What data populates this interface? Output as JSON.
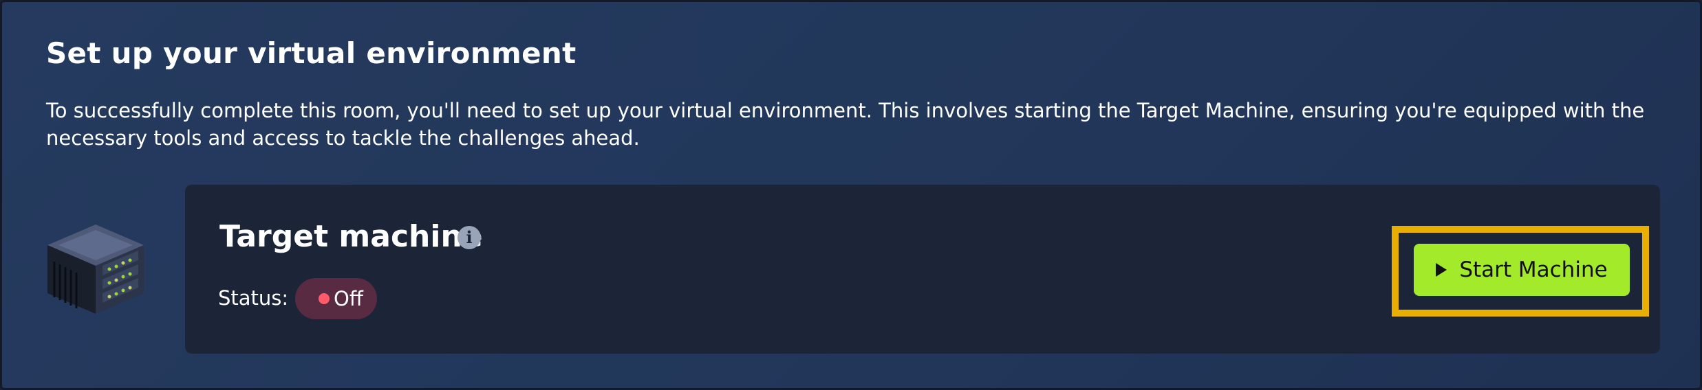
{
  "section": {
    "title": "Set up your virtual environment",
    "description": "To successfully complete this room, you'll need to set up your virtual environment. This involves starting the Target Machine, ensuring you're equipped with the necessary tools and access to tackle the challenges ahead."
  },
  "machine": {
    "icon": "server-icon",
    "title": "Target machine",
    "info_icon": "info-icon",
    "info_glyph": "i",
    "status_label": "Status:",
    "status_value": "Off",
    "status_color": "#ff5a69",
    "start_button": {
      "icon": "play-icon",
      "label": "Start Machine",
      "color": "#a3ea2a"
    },
    "highlight_color": "#e8af00"
  }
}
